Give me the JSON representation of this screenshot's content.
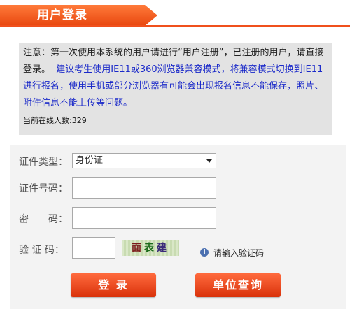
{
  "header": {
    "title": "用户登录"
  },
  "notice": {
    "text_black": "注意：第一次使用本系统的用户请进行“用户注册”，已注册的用户，请直接登录。",
    "text_blue": "建议考生使用IE11或360浏览器兼容模式，将兼容模式切换到IE11进行报名，使用手机或部分浏览器有可能会出现报名信息不能保存，照片、附件信息不能上传等问题。",
    "online_label": "当前在线人数:",
    "online_count": "329"
  },
  "form": {
    "id_type_label": "证件类型：",
    "id_type_value": "身份证",
    "id_number_label": "证件号码：",
    "password_label": "密　　码：",
    "captcha_label": "验 证 码：",
    "captcha_chars": [
      "面",
      "表",
      "建"
    ],
    "captcha_hint": "请输入验证码"
  },
  "buttons": {
    "login": "登 录",
    "unit_query": "单位查询"
  },
  "colors": {
    "accent": "#f0501c",
    "notice_bg": "#e3e3e3",
    "notice_blue": "#1a29c9"
  }
}
